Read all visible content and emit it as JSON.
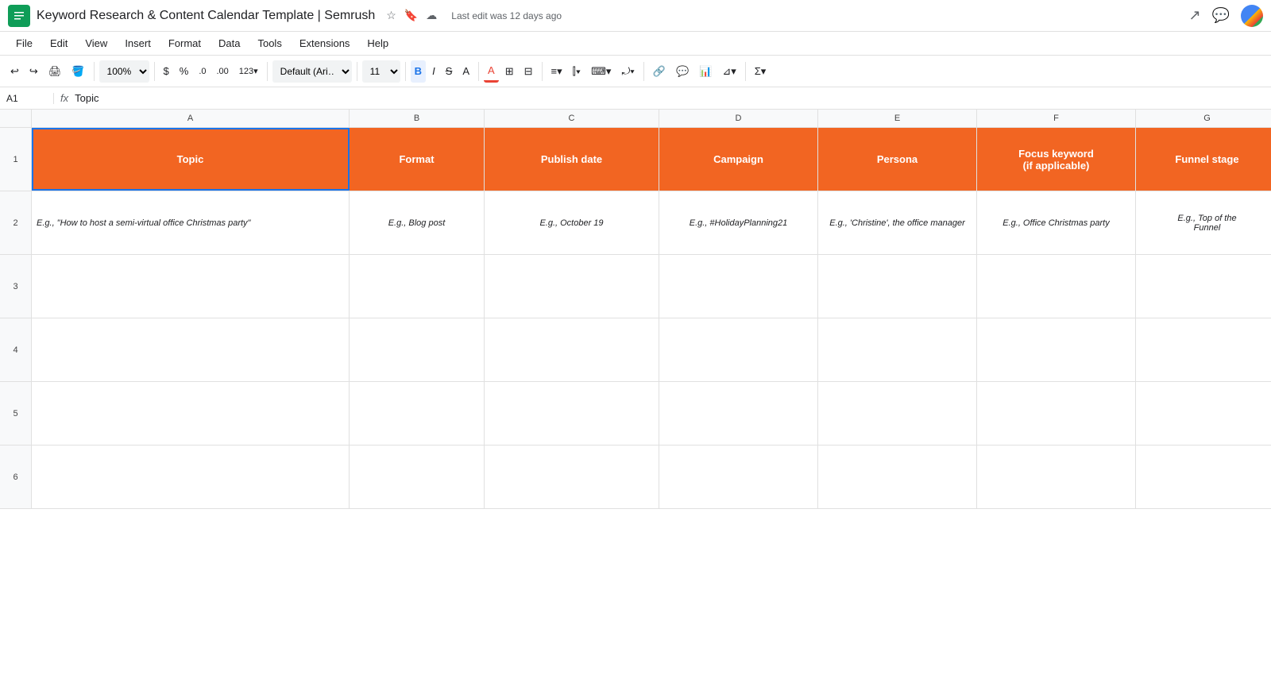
{
  "title": "Keyword Research & Content Calendar Template | Semrush",
  "last_edit": "Last edit was 12 days ago",
  "menu": {
    "items": [
      "File",
      "Edit",
      "View",
      "Insert",
      "Format",
      "Data",
      "Tools",
      "Extensions",
      "Help"
    ]
  },
  "toolbar": {
    "zoom": "100%",
    "font": "Default (Ari…",
    "font_size": "11",
    "bold": "B",
    "italic": "I",
    "strikethrough": "S",
    "text_color": "A"
  },
  "formula_bar": {
    "cell_ref": "A1",
    "fx": "fx",
    "formula": "Topic"
  },
  "columns": {
    "headers": [
      "A",
      "B",
      "C",
      "D",
      "E",
      "F",
      "G"
    ],
    "labels": [
      "Topic",
      "Format",
      "Publish date",
      "Campaign",
      "Persona",
      "Focus keyword (if applicable)",
      "Funnel stage"
    ]
  },
  "rows": {
    "row1": {
      "num": "1",
      "a": "Topic",
      "b": "Format",
      "c": "Publish date",
      "d": "Campaign",
      "e": "Persona",
      "f": "Focus keyword (if applicable)",
      "g": "Funnel stage"
    },
    "row2": {
      "num": "2",
      "a": "E.g., \"How to host a semi-virtual office Christmas party\"",
      "b": "E.g., Blog post",
      "c": "E.g., October 19",
      "d": "E.g., #HolidayPlanning21",
      "e": "E.g., 'Christine', the office manager",
      "f": "E.g., Office Christmas party",
      "g": "E.g., Top of the Funnel"
    },
    "row3": {
      "num": "3",
      "a": "",
      "b": "",
      "c": "",
      "d": "",
      "e": "",
      "f": "",
      "g": ""
    },
    "row4": {
      "num": "4",
      "a": "",
      "b": "",
      "c": "",
      "d": "",
      "e": "",
      "f": "",
      "g": ""
    },
    "row5": {
      "num": "5",
      "a": "",
      "b": "",
      "c": "",
      "d": "",
      "e": "",
      "f": "",
      "g": ""
    },
    "row6": {
      "num": "6",
      "a": "",
      "b": "",
      "c": "",
      "d": "",
      "e": "",
      "f": "",
      "g": ""
    }
  },
  "icons": {
    "undo": "↩",
    "redo": "↪",
    "print": "🖨",
    "paint": "🪣",
    "zoom_down": "▾",
    "dollar": "$",
    "percent": "%",
    "decimal0": ".0",
    "decimal00": ".00",
    "format123": "123",
    "bold_icon": "B",
    "italic_icon": "I",
    "strike_icon": "S",
    "text_a": "A",
    "fill": "A",
    "borders": "⊞",
    "merge": "⊟",
    "align_h": "≡",
    "align_v": "⫿",
    "wrap": "⌨",
    "rotate": "⤾",
    "link": "🔗",
    "comment": "💬",
    "chart": "📊",
    "filter": "⊿",
    "sum": "Σ",
    "star": "☆",
    "bookmark": "🔖",
    "cloud": "☁",
    "trending": "↗",
    "chat": "💬",
    "google_apps": "⬛"
  }
}
